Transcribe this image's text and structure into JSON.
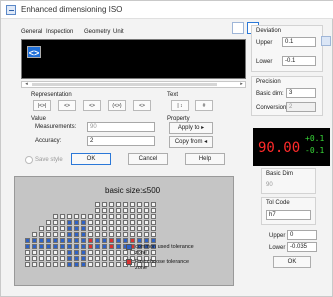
{
  "window": {
    "title": "Enhanced dimensioning ISO"
  },
  "tabs": [
    "General",
    "Inspection",
    "Geometry",
    "Unit"
  ],
  "preview_button_label": "<>",
  "representation": {
    "title": "Representation",
    "buttons": [
      "|<>|",
      "<>",
      "<>",
      "(<>)",
      "<>"
    ]
  },
  "text": {
    "title": "Text",
    "left_button": "| ↕",
    "right_button": "#"
  },
  "value": {
    "title": "Value",
    "measurements_label": "Measurements:",
    "measurements_value": "90",
    "accuracy_label": "Accuracy:",
    "accuracy_value": "2"
  },
  "property": {
    "title": "Property",
    "apply_label": "Apply to ▸",
    "copy_label": "Copy from ◂"
  },
  "bottom": {
    "save_style_label": "Save style",
    "ok_label": "OK",
    "cancel_label": "Cancel",
    "help_label": "Help"
  },
  "deviation": {
    "title": "Deviation",
    "upper_label": "Upper",
    "upper_value": "0.1",
    "lower_label": "Lower",
    "lower_value": "-0.1"
  },
  "precision": {
    "title": "Precision",
    "basic_label": "Basic dim:",
    "basic_value": "3",
    "conversion_label": "Conversion",
    "conversion_value": "2"
  },
  "lcd": {
    "main_value": "90.00",
    "upper_value": "+0.1",
    "lower_value": "-0.1"
  },
  "basic_dim": {
    "label": "Basic Dim",
    "value": "90"
  },
  "tol_code": {
    "label": "Tol Code",
    "value": "h7"
  },
  "tol_values": {
    "upper_label": "Upper",
    "upper_value": "0",
    "lower_label": "Lower",
    "lower_value": "-0.035"
  },
  "ok_bottom": "OK",
  "chart": {
    "title": "basic size:≤500",
    "legend": [
      {
        "label": "common used tolerance zone",
        "color": "#2f62c5"
      },
      {
        "label": "First choose tolerance zone",
        "color": "#d83232"
      }
    ]
  },
  "colors": {
    "accent": "#1f6fd8",
    "red": "#ff2a2a",
    "green": "#38d838"
  }
}
